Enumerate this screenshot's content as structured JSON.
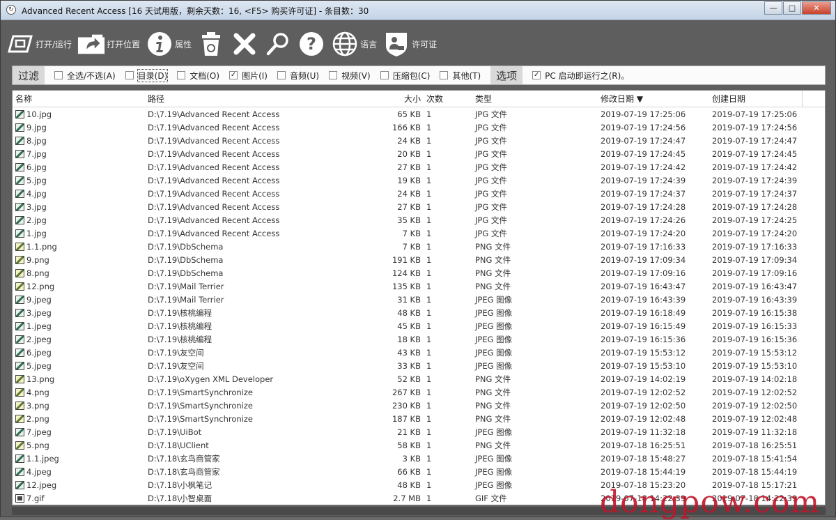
{
  "window": {
    "title": "Advanced Recent Access [16 天试用版，剩余天数：16, <F5> 购买许可证] - 条目数：30",
    "controls": {
      "minimize": "—",
      "maximize": "□",
      "close": "✕"
    }
  },
  "toolbar": {
    "items": [
      {
        "icon": "open-run-icon",
        "label": "打开/运行"
      },
      {
        "icon": "open-location-icon",
        "label": "打开位置"
      },
      {
        "icon": "info-icon",
        "label": "属性"
      },
      {
        "icon": "recycle-bin-icon",
        "label": ""
      },
      {
        "icon": "delete-x-icon",
        "label": ""
      },
      {
        "icon": "search-icon",
        "label": ""
      },
      {
        "icon": "help-icon",
        "label": ""
      },
      {
        "icon": "globe-icon",
        "label": "语言"
      },
      {
        "icon": "license-shield-icon",
        "label": "许可证"
      }
    ]
  },
  "filter": {
    "heading": "过滤",
    "options_heading": "选项",
    "checkboxes": [
      {
        "label": "全选/不选(A)",
        "checked": false
      },
      {
        "label": "目录(D)",
        "checked": false,
        "focused": true
      },
      {
        "label": "文档(O)",
        "checked": false
      },
      {
        "label": "图片(I)",
        "checked": true
      },
      {
        "label": "音频(U)",
        "checked": false
      },
      {
        "label": "视频(V)",
        "checked": false
      },
      {
        "label": "压缩包(C)",
        "checked": false
      },
      {
        "label": "其他(T)",
        "checked": false
      }
    ],
    "startup_option": {
      "label": "PC 启动即运行之(R)。",
      "checked": true
    }
  },
  "list": {
    "columns": [
      "名称",
      "路径",
      "大小",
      "次数",
      "类型",
      "修改日期 ▼",
      "创建日期"
    ],
    "rows": [
      {
        "name": "10.jpg",
        "kind": "jpg",
        "path": "D:\\7.19\\Advanced Recent Access",
        "size": "65 KB",
        "count": "1",
        "type": "JPG 文件",
        "modified": "2019-07-19 17:25:06",
        "created": "2019-07-19 17:25:06"
      },
      {
        "name": "9.jpg",
        "kind": "jpg",
        "path": "D:\\7.19\\Advanced Recent Access",
        "size": "166 KB",
        "count": "1",
        "type": "JPG 文件",
        "modified": "2019-07-19 17:24:56",
        "created": "2019-07-19 17:24:56"
      },
      {
        "name": "8.jpg",
        "kind": "jpg",
        "path": "D:\\7.19\\Advanced Recent Access",
        "size": "24 KB",
        "count": "1",
        "type": "JPG 文件",
        "modified": "2019-07-19 17:24:47",
        "created": "2019-07-19 17:24:47"
      },
      {
        "name": "7.jpg",
        "kind": "jpg",
        "path": "D:\\7.19\\Advanced Recent Access",
        "size": "20 KB",
        "count": "1",
        "type": "JPG 文件",
        "modified": "2019-07-19 17:24:45",
        "created": "2019-07-19 17:24:45"
      },
      {
        "name": "6.jpg",
        "kind": "jpg",
        "path": "D:\\7.19\\Advanced Recent Access",
        "size": "27 KB",
        "count": "1",
        "type": "JPG 文件",
        "modified": "2019-07-19 17:24:42",
        "created": "2019-07-19 17:24:42"
      },
      {
        "name": "5.jpg",
        "kind": "jpg",
        "path": "D:\\7.19\\Advanced Recent Access",
        "size": "19 KB",
        "count": "1",
        "type": "JPG 文件",
        "modified": "2019-07-19 17:24:39",
        "created": "2019-07-19 17:24:39"
      },
      {
        "name": "4.jpg",
        "kind": "jpg",
        "path": "D:\\7.19\\Advanced Recent Access",
        "size": "24 KB",
        "count": "1",
        "type": "JPG 文件",
        "modified": "2019-07-19 17:24:37",
        "created": "2019-07-19 17:24:37"
      },
      {
        "name": "3.jpg",
        "kind": "jpg",
        "path": "D:\\7.19\\Advanced Recent Access",
        "size": "27 KB",
        "count": "1",
        "type": "JPG 文件",
        "modified": "2019-07-19 17:24:28",
        "created": "2019-07-19 17:24:28"
      },
      {
        "name": "2.jpg",
        "kind": "jpg",
        "path": "D:\\7.19\\Advanced Recent Access",
        "size": "35 KB",
        "count": "1",
        "type": "JPG 文件",
        "modified": "2019-07-19 17:24:26",
        "created": "2019-07-19 17:24:25"
      },
      {
        "name": "1.jpg",
        "kind": "jpg",
        "path": "D:\\7.19\\Advanced Recent Access",
        "size": "7 KB",
        "count": "1",
        "type": "JPG 文件",
        "modified": "2019-07-19 17:24:20",
        "created": "2019-07-19 17:24:20"
      },
      {
        "name": "1.1.png",
        "kind": "png",
        "path": "D:\\7.19\\DbSchema",
        "size": "7 KB",
        "count": "1",
        "type": "PNG 文件",
        "modified": "2019-07-19 17:16:33",
        "created": "2019-07-19 17:16:33"
      },
      {
        "name": "9.png",
        "kind": "png",
        "path": "D:\\7.19\\DbSchema",
        "size": "191 KB",
        "count": "1",
        "type": "PNG 文件",
        "modified": "2019-07-19 17:09:34",
        "created": "2019-07-19 17:09:34"
      },
      {
        "name": "8.png",
        "kind": "png",
        "path": "D:\\7.19\\DbSchema",
        "size": "124 KB",
        "count": "1",
        "type": "PNG 文件",
        "modified": "2019-07-19 17:09:16",
        "created": "2019-07-19 17:09:16"
      },
      {
        "name": "12.png",
        "kind": "png",
        "path": "D:\\7.19\\Mail Terrier",
        "size": "135 KB",
        "count": "1",
        "type": "PNG 文件",
        "modified": "2019-07-19 16:43:47",
        "created": "2019-07-19 16:43:47"
      },
      {
        "name": "9.jpeg",
        "kind": "jpg",
        "path": "D:\\7.19\\Mail Terrier",
        "size": "31 KB",
        "count": "1",
        "type": "JPEG 图像",
        "modified": "2019-07-19 16:43:39",
        "created": "2019-07-19 16:43:39"
      },
      {
        "name": "3.jpeg",
        "kind": "jpg",
        "path": "D:\\7.19\\核桃编程",
        "size": "48 KB",
        "count": "1",
        "type": "JPEG 图像",
        "modified": "2019-07-19 16:18:49",
        "created": "2019-07-19 16:15:38"
      },
      {
        "name": "1.jpeg",
        "kind": "jpg",
        "path": "D:\\7.19\\核桃编程",
        "size": "45 KB",
        "count": "1",
        "type": "JPEG 图像",
        "modified": "2019-07-19 16:15:49",
        "created": "2019-07-19 16:15:33"
      },
      {
        "name": "2.jpeg",
        "kind": "jpg",
        "path": "D:\\7.19\\核桃编程",
        "size": "18 KB",
        "count": "1",
        "type": "JPEG 图像",
        "modified": "2019-07-19 16:15:36",
        "created": "2019-07-19 16:15:36"
      },
      {
        "name": "6.jpeg",
        "kind": "jpg",
        "path": "D:\\7.19\\友空间",
        "size": "43 KB",
        "count": "1",
        "type": "JPEG 图像",
        "modified": "2019-07-19 15:53:12",
        "created": "2019-07-19 15:53:12"
      },
      {
        "name": "5.jpeg",
        "kind": "jpg",
        "path": "D:\\7.19\\友空间",
        "size": "33 KB",
        "count": "1",
        "type": "JPEG 图像",
        "modified": "2019-07-19 15:53:10",
        "created": "2019-07-19 15:53:10"
      },
      {
        "name": "13.png",
        "kind": "png",
        "path": "D:\\7.19\\oXygen XML Developer",
        "size": "52 KB",
        "count": "1",
        "type": "PNG 文件",
        "modified": "2019-07-19 14:02:19",
        "created": "2019-07-19 14:02:18"
      },
      {
        "name": "4.png",
        "kind": "png",
        "path": "D:\\7.19\\SmartSynchronize",
        "size": "267 KB",
        "count": "1",
        "type": "PNG 文件",
        "modified": "2019-07-19 12:02:52",
        "created": "2019-07-19 12:02:52"
      },
      {
        "name": "3.png",
        "kind": "png",
        "path": "D:\\7.19\\SmartSynchronize",
        "size": "230 KB",
        "count": "1",
        "type": "PNG 文件",
        "modified": "2019-07-19 12:02:50",
        "created": "2019-07-19 12:02:50"
      },
      {
        "name": "2.png",
        "kind": "png",
        "path": "D:\\7.19\\SmartSynchronize",
        "size": "187 KB",
        "count": "1",
        "type": "PNG 文件",
        "modified": "2019-07-19 12:02:48",
        "created": "2019-07-19 12:02:48"
      },
      {
        "name": "7.jpeg",
        "kind": "jpg",
        "path": "D:\\7.19\\UiBot",
        "size": "21 KB",
        "count": "1",
        "type": "JPEG 图像",
        "modified": "2019-07-19 11:32:18",
        "created": "2019-07-19 11:32:18"
      },
      {
        "name": "5.png",
        "kind": "png",
        "path": "D:\\7.18\\UClient",
        "size": "58 KB",
        "count": "1",
        "type": "PNG 文件",
        "modified": "2019-07-18 16:25:51",
        "created": "2019-07-18 16:25:51"
      },
      {
        "name": "1.1.jpeg",
        "kind": "jpg",
        "path": "D:\\7.18\\玄鸟商管家",
        "size": "3 KB",
        "count": "1",
        "type": "JPEG 图像",
        "modified": "2019-07-18 15:48:27",
        "created": "2019-07-18 15:41:54"
      },
      {
        "name": "4.jpeg",
        "kind": "jpg",
        "path": "D:\\7.18\\玄鸟商管家",
        "size": "66 KB",
        "count": "1",
        "type": "JPEG 图像",
        "modified": "2019-07-18 15:44:19",
        "created": "2019-07-18 15:44:19"
      },
      {
        "name": "12.jpeg",
        "kind": "jpg",
        "path": "D:\\7.18\\小枫笔记",
        "size": "48 KB",
        "count": "1",
        "type": "JPEG 图像",
        "modified": "2019-07-18 15:23:20",
        "created": "2019-07-18 15:17:21"
      },
      {
        "name": "7.gif",
        "kind": "gif",
        "path": "D:\\7.18\\小智桌面",
        "size": "2.7 MB",
        "count": "1",
        "type": "GIF 文件",
        "modified": "2019-07-18 14:22:39",
        "created": "2019-07-18 14:22:39"
      }
    ]
  },
  "watermark": "dongpow.com"
}
